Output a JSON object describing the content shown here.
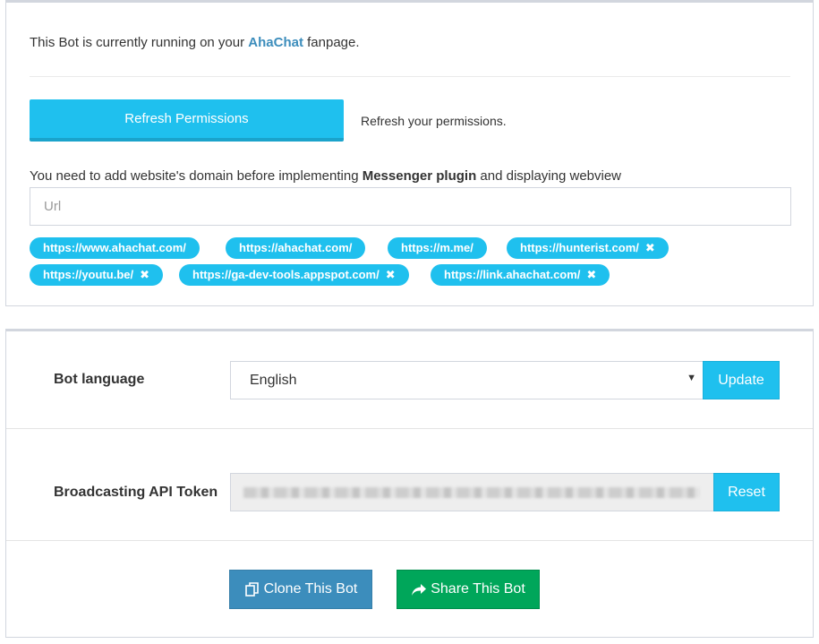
{
  "permissions": {
    "running_prefix": "This Bot is currently running on your ",
    "page_name": "AhaChat",
    "running_suffix": " fanpage.",
    "refresh_button": "Refresh Permissions",
    "refresh_note": "Refresh your permissions."
  },
  "domains": {
    "text_prefix": "You need to add website's domain before implementing ",
    "text_bold": "Messenger plugin",
    "text_suffix": " and displaying webview",
    "input_placeholder": "Url",
    "input_value": "",
    "tags": [
      {
        "label": "https://www.ahachat.com/",
        "removable": false
      },
      {
        "label": "https://ahachat.com/",
        "removable": false
      },
      {
        "label": "https://m.me/",
        "removable": false
      },
      {
        "label": "https://hunterist.com/",
        "removable": true
      },
      {
        "label": "https://youtu.be/",
        "removable": true
      },
      {
        "label": "https://ga-dev-tools.appspot.com/",
        "removable": true
      },
      {
        "label": "https://link.ahachat.com/",
        "removable": true
      }
    ],
    "remove_glyph": "✖"
  },
  "settings": {
    "language_label": "Bot language",
    "language_value": "English",
    "update_button": "Update",
    "token_label": "Broadcasting API Token",
    "reset_button": "Reset",
    "clone_button": "Clone This Bot",
    "share_button": "Share This Bot"
  },
  "colors": {
    "accent": "#1fc0ee",
    "link": "#3c8dbc",
    "clone": "#3c8dbc",
    "share": "#00a65a"
  },
  "icons": {
    "clone": "clone-icon",
    "share": "share-icon",
    "select_arrow": "caret-down-icon",
    "tag_remove": "close-icon"
  }
}
